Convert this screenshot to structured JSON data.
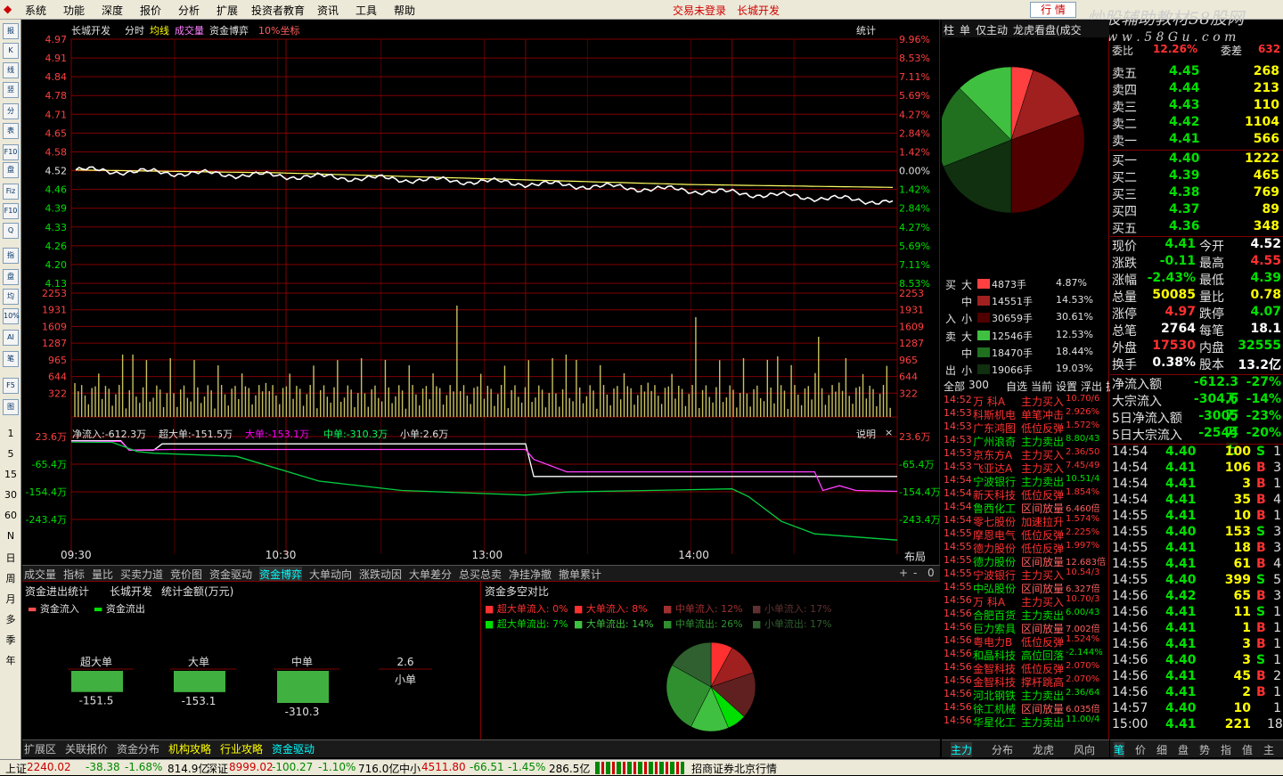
{
  "menu": {
    "items": [
      "系统",
      "功能",
      "深度",
      "报价",
      "分析",
      "扩展",
      "投资者教育",
      "资讯",
      "工具",
      "帮助"
    ],
    "login": "交易未登录",
    "stock": "长城开发",
    "hq_button": "行 情"
  },
  "watermark": {
    "line1": "炒股辅助教材58股网",
    "line2": "w w w . 5 8 G u . c o m"
  },
  "left_toolbar": {
    "buttons": [
      "报",
      "K",
      "线",
      "竖",
      "分",
      "表",
      "F10",
      "盘",
      "Fiz",
      "F10",
      "Q",
      "指",
      "盘",
      "均",
      "10%",
      "AI",
      "笔",
      "F5",
      "图"
    ],
    "periods": [
      "1",
      "5",
      "15",
      "30",
      "60",
      "N",
      "日",
      "周",
      "月",
      "多",
      "季",
      "年"
    ]
  },
  "chart": {
    "header": {
      "name": "长城开发",
      "mode": "分时",
      "avg": "均线",
      "vol": "成交量",
      "game": "资金博弈",
      "coord": "10%坐标",
      "stat": "统计"
    },
    "price_ticks": [
      "4.97",
      "4.91",
      "4.84",
      "4.78",
      "4.71",
      "4.65",
      "4.58",
      "4.52",
      "4.46",
      "4.39",
      "4.33",
      "4.26",
      "4.20",
      "4.13"
    ],
    "pct_ticks": [
      "9.96%",
      "8.53%",
      "7.11%",
      "5.69%",
      "4.27%",
      "2.84%",
      "1.42%",
      "0.00%",
      "1.42%",
      "2.84%",
      "4.27%",
      "5.69%",
      "7.11%",
      "8.53%"
    ],
    "vol_ticks": [
      "2253",
      "1931",
      "1609",
      "1287",
      "965",
      "644",
      "322"
    ],
    "flow_header": {
      "net": "净流入:-612.3万",
      "super": "超大单:-151.5万",
      "large": "大单:-153.1万",
      "mid": "中单:-310.3万",
      "small": "小单:2.6万",
      "explain": "说明",
      "close": "×"
    },
    "flow_ticks": [
      "23.6万",
      "-65.4万",
      "-154.4万",
      "-243.4万"
    ],
    "time_ticks": [
      "09:30",
      "10:30",
      "13:00",
      "14:00"
    ],
    "layout_label": "布局"
  },
  "chart_data": {
    "type": "line",
    "title": "长城开发 分时",
    "x": [
      "09:30",
      "10:30",
      "13:00",
      "14:00",
      "15:00"
    ],
    "series": [
      {
        "name": "价格",
        "values": [
          4.52,
          4.5,
          4.48,
          4.45,
          4.41
        ]
      },
      {
        "name": "均线",
        "values": [
          4.52,
          4.51,
          4.49,
          4.47,
          4.46
        ]
      }
    ],
    "ylim": [
      4.13,
      4.97
    ],
    "flow": {
      "net": -612.3,
      "super": -151.5,
      "large": -153.1,
      "mid": -310.3,
      "small": 2.6
    }
  },
  "bottom_tabs": [
    "成交量",
    "指标",
    "量比",
    "买卖力道",
    "竞价图",
    "资金驱动",
    "资金博弈",
    "大单动向",
    "涨跌动因",
    "大单差分",
    "总买总卖",
    "净挂净撤",
    "撤单累计"
  ],
  "bottom_tab_active": "资金博弈",
  "stats": {
    "title": "资金进出统计",
    "stock": "长城开发",
    "unit": "统计金额(万元)",
    "legend_in": "资金流入",
    "legend_out": "资金流出",
    "bars": [
      {
        "label": "超大单",
        "value": "-151.5"
      },
      {
        "label": "大单",
        "value": "-153.1"
      },
      {
        "label": "中单",
        "value": "-310.3"
      },
      {
        "label": "小单",
        "value": "2.6"
      }
    ]
  },
  "compare": {
    "title": "资金多空对比",
    "inflow": [
      {
        "label": "超大单流入:",
        "pct": "0%"
      },
      {
        "label": "大单流入:",
        "pct": "8%"
      },
      {
        "label": "中单流入:",
        "pct": "12%"
      },
      {
        "label": "小单流入:",
        "pct": "17%"
      }
    ],
    "outflow": [
      {
        "label": "超大单流出:",
        "pct": "7%"
      },
      {
        "label": "大单流出:",
        "pct": "14%"
      },
      {
        "label": "中单流出:",
        "pct": "26%"
      },
      {
        "label": "小单流出:",
        "pct": "17%"
      }
    ]
  },
  "ext_tabs": [
    "扩展区",
    "关联报价",
    "资金分布",
    "机构攻略",
    "行业攻略",
    "资金驱动"
  ],
  "mid_panel": {
    "tabs": [
      "柱",
      "单",
      "仅主动",
      "龙虎看盘(成交"
    ],
    "buy": [
      {
        "size": "大",
        "hands": "4873手",
        "pct": "4.87%"
      },
      {
        "size": "中",
        "hands": "14551手",
        "pct": "14.53%"
      },
      {
        "size": "小",
        "hands": "30659手",
        "pct": "30.61%"
      }
    ],
    "sell": [
      {
        "size": "大",
        "hands": "12546手",
        "pct": "12.53%"
      },
      {
        "size": "中",
        "hands": "18470手",
        "pct": "18.44%"
      },
      {
        "size": "小",
        "hands": "19066手",
        "pct": "19.03%"
      }
    ],
    "buy_label": [
      "买",
      "入"
    ],
    "sell_label": [
      "卖",
      "出"
    ],
    "filter": [
      "全部",
      "300",
      "自选",
      "当前",
      "设置",
      "浮出",
      "扩"
    ],
    "news": [
      {
        "t": "14:52",
        "n": "万  科A",
        "e": "主力买入",
        "v": "10.70/6"
      },
      {
        "t": "14:53",
        "n": "科斯机电",
        "e": "单笔冲击",
        "v": "2.926%"
      },
      {
        "t": "14:53",
        "n": "广东鸿图",
        "e": "低位反弹",
        "v": "1.572%"
      },
      {
        "t": "14:53",
        "n": "广州浪奇",
        "e": "主力卖出",
        "v": "8.80/43"
      },
      {
        "t": "14:53",
        "n": "京东方A",
        "e": "主力买入",
        "v": "2.36/50"
      },
      {
        "t": "14:53",
        "n": "飞亚达A",
        "e": "主力买入",
        "v": "7.45/49"
      },
      {
        "t": "14:54",
        "n": "宁波银行",
        "e": "主力卖出",
        "v": "10.51/4"
      },
      {
        "t": "14:54",
        "n": "新天科技",
        "e": "低位反弹",
        "v": "1.854%"
      },
      {
        "t": "14:54",
        "n": "鲁西化工",
        "e": "区间放量",
        "v": "6.460倍"
      },
      {
        "t": "14:54",
        "n": "零七股份",
        "e": "加速拉升",
        "v": "1.574%"
      },
      {
        "t": "14:55",
        "n": "摩恩电气",
        "e": "低位反弹",
        "v": "2.225%"
      },
      {
        "t": "14:55",
        "n": "德力股份",
        "e": "低位反弹",
        "v": "1.997%"
      },
      {
        "t": "14:55",
        "n": "德力股份",
        "e": "区间放量",
        "v": "12.683倍"
      },
      {
        "t": "14:55",
        "n": "宁波银行",
        "e": "主力买入",
        "v": "10.54/3"
      },
      {
        "t": "14:55",
        "n": "中弘股份",
        "e": "区间放量",
        "v": "6.327倍"
      },
      {
        "t": "14:56",
        "n": "万  科A",
        "e": "主力买入",
        "v": "10.70/3"
      },
      {
        "t": "14:56",
        "n": "合肥百货",
        "e": "主力卖出",
        "v": "6.00/43"
      },
      {
        "t": "14:56",
        "n": "巨力索具",
        "e": "区间放量",
        "v": "7.002倍"
      },
      {
        "t": "14:56",
        "n": "粤电力B",
        "e": "低位反弹",
        "v": "1.524%"
      },
      {
        "t": "14:56",
        "n": "和晶科技",
        "e": "高位回落",
        "v": "-2.144%"
      },
      {
        "t": "14:56",
        "n": "金智科技",
        "e": "低位反弹",
        "v": "2.070%"
      },
      {
        "t": "14:56",
        "n": "金智科技",
        "e": "撑杆跳高",
        "v": "2.070%"
      },
      {
        "t": "14:56",
        "n": "河北钢铁",
        "e": "主力卖出",
        "v": "2.36/64"
      },
      {
        "t": "14:56",
        "n": "徐工机械",
        "e": "区间放量",
        "v": "6.035倍"
      },
      {
        "t": "14:56",
        "n": "华星化工",
        "e": "主力卖出",
        "v": "11.00/4"
      }
    ],
    "bottom_tabs": [
      "主力",
      "分布",
      "龙虎",
      "风向"
    ]
  },
  "right_panel": {
    "weibi": {
      "label": "委比",
      "value": "12.26%",
      "label2": "委差",
      "value2": "632"
    },
    "asks": [
      {
        "l": "卖五",
        "p": "4.45",
        "v": "268"
      },
      {
        "l": "卖四",
        "p": "4.44",
        "v": "213"
      },
      {
        "l": "卖三",
        "p": "4.43",
        "v": "110"
      },
      {
        "l": "卖二",
        "p": "4.42",
        "v": "1104"
      },
      {
        "l": "卖一",
        "p": "4.41",
        "v": "566"
      }
    ],
    "bids": [
      {
        "l": "买一",
        "p": "4.40",
        "v": "1222"
      },
      {
        "l": "买二",
        "p": "4.39",
        "v": "465"
      },
      {
        "l": "买三",
        "p": "4.38",
        "v": "769"
      },
      {
        "l": "买四",
        "p": "4.37",
        "v": "89"
      },
      {
        "l": "买五",
        "p": "4.36",
        "v": "348"
      }
    ],
    "quote": [
      {
        "l1": "现价",
        "v1": "4.41",
        "l2": "今开",
        "v2": "4.52"
      },
      {
        "l1": "涨跌",
        "v1": "-0.11",
        "l2": "最高",
        "v2": "4.55"
      },
      {
        "l1": "涨幅",
        "v1": "-2.43%",
        "l2": "最低",
        "v2": "4.39"
      },
      {
        "l1": "总量",
        "v1": "50085",
        "l2": "量比",
        "v2": "0.78"
      },
      {
        "l1": "涨停",
        "v1": "4.97",
        "l2": "跌停",
        "v2": "4.07"
      },
      {
        "l1": "总笔",
        "v1": "2764",
        "l2": "每笔",
        "v2": "18.1"
      },
      {
        "l1": "外盘",
        "v1": "17530",
        "l2": "内盘",
        "v2": "32555"
      },
      {
        "l1": "换手",
        "v1": "0.38%",
        "l2": "股本",
        "v2": "13.2亿"
      }
    ],
    "flows": [
      {
        "l": "净流入额",
        "v": "-612.3万",
        "p": "-27%"
      },
      {
        "l": "大宗流入",
        "v": "-304.6万",
        "p": "-14%"
      },
      {
        "l": "5日净流入额",
        "v": "-3005万",
        "p": "-23%"
      },
      {
        "l": "5日大宗流入",
        "v": "-2544万",
        "p": "-20%"
      }
    ],
    "ticks": [
      {
        "t": "14:54",
        "p": "4.40",
        "v": "100",
        "s": "S",
        "n": "1"
      },
      {
        "t": "14:54",
        "p": "4.41",
        "v": "106",
        "s": "B",
        "n": "3"
      },
      {
        "t": "14:54",
        "p": "4.41",
        "v": "3",
        "s": "B",
        "n": "1"
      },
      {
        "t": "14:54",
        "p": "4.41",
        "v": "35",
        "s": "B",
        "n": "4"
      },
      {
        "t": "14:55",
        "p": "4.41",
        "v": "10",
        "s": "B",
        "n": "1"
      },
      {
        "t": "14:55",
        "p": "4.40",
        "v": "153",
        "s": "S",
        "n": "3"
      },
      {
        "t": "14:55",
        "p": "4.41",
        "v": "18",
        "s": "B",
        "n": "3"
      },
      {
        "t": "14:55",
        "p": "4.41",
        "v": "61",
        "s": "B",
        "n": "4"
      },
      {
        "t": "14:55",
        "p": "4.40",
        "v": "399",
        "s": "S",
        "n": "5"
      },
      {
        "t": "14:56",
        "p": "4.42",
        "v": "65",
        "s": "B",
        "n": "3"
      },
      {
        "t": "14:56",
        "p": "4.41",
        "v": "11",
        "s": "S",
        "n": "1"
      },
      {
        "t": "14:56",
        "p": "4.41",
        "v": "1",
        "s": "B",
        "n": "1"
      },
      {
        "t": "14:56",
        "p": "4.41",
        "v": "3",
        "s": "B",
        "n": "1"
      },
      {
        "t": "14:56",
        "p": "4.40",
        "v": "3",
        "s": "S",
        "n": "1"
      },
      {
        "t": "14:56",
        "p": "4.41",
        "v": "45",
        "s": "B",
        "n": "2"
      },
      {
        "t": "14:56",
        "p": "4.41",
        "v": "2",
        "s": "B",
        "n": "1"
      },
      {
        "t": "14:57",
        "p": "4.40",
        "v": "10",
        "s": "",
        "n": "1"
      },
      {
        "t": "15:00",
        "p": "4.41",
        "v": "221",
        "s": "",
        "n": "18"
      }
    ],
    "bottom_tabs": [
      "笔",
      "价",
      "细",
      "盘",
      "势",
      "指",
      "值",
      "主"
    ]
  },
  "status": {
    "sh_name": "上证",
    "sh_val": "2240.02",
    "sh_chg": "-38.38",
    "sh_pct": "-1.68%",
    "sh_amt": "814.9亿",
    "sz_name": "深证",
    "sz_val": "8999.02",
    "sz_chg": "-100.27",
    "sz_pct": "-1.10%",
    "sz_amt": "716.0亿",
    "zx_name": "中小",
    "zx_val": "4511.80",
    "zx_chg": "-66.51",
    "zx_pct": "-1.45%",
    "zx_amt": "286.5亿",
    "broker": "招商证券北京行情"
  },
  "colors": {
    "up": "#ff3030",
    "down": "#00e000",
    "grid": "#800000",
    "price": "#ffffff",
    "avg": "#ffff00",
    "vol": "#c8c060",
    "accent": "#00ffff"
  }
}
